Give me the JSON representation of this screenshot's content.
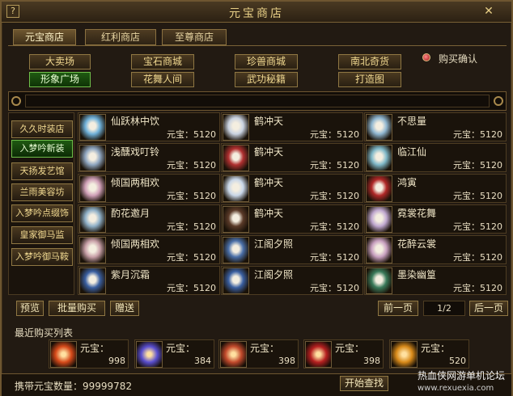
{
  "window": {
    "title": "元宝商店",
    "help": "?",
    "close": "✕"
  },
  "tabs": [
    "元宝商店",
    "红利商店",
    "至尊商店"
  ],
  "categories": [
    "大卖场",
    "宝石商城",
    "珍兽商城",
    "南北奇货",
    "形象广场",
    "花舞人间",
    "武功秘籍",
    "打造图"
  ],
  "confirm_label": "购买确认",
  "sidebar": [
    "久久时装店",
    "入梦吟新装",
    "天扬发艺馆",
    "兰雨美容坊",
    "入梦吟点缀饰",
    "皇家御马监",
    "入梦吟御马鞍"
  ],
  "price_prefix": "元宝：",
  "items": [
    {
      "name": "仙跃林中饮",
      "price": "5120"
    },
    {
      "name": "鹤冲天",
      "price": "5120"
    },
    {
      "name": "不思量",
      "price": "5120"
    },
    {
      "name": "浅醺戏叮铃",
      "price": "5120"
    },
    {
      "name": "鹤冲天",
      "price": "5120"
    },
    {
      "name": "临江仙",
      "price": "5120"
    },
    {
      "name": "倾国两相欢",
      "price": "5120"
    },
    {
      "name": "鹤冲天",
      "price": "5120"
    },
    {
      "name": "鸿寅",
      "price": "5120"
    },
    {
      "name": "酌花邀月",
      "price": "5120"
    },
    {
      "name": "鹤冲天",
      "price": "5120"
    },
    {
      "name": "霓裳花舞",
      "price": "5120"
    },
    {
      "name": "倾国两相欢",
      "price": "5120"
    },
    {
      "name": "江阁夕照",
      "price": "5120"
    },
    {
      "name": "花醉云裳",
      "price": "5120"
    },
    {
      "name": "紫月沉霜",
      "price": "5120"
    },
    {
      "name": "江阁夕照",
      "price": "5120"
    },
    {
      "name": "墨染幽篁",
      "price": "5120"
    }
  ],
  "actions": {
    "preview": "预览",
    "bulk": "批量购买",
    "gift": "赠送"
  },
  "pager": {
    "prev": "前一页",
    "page": "1/2",
    "next": "后一页"
  },
  "recent": {
    "title": "最近购买列表",
    "label": "元宝：",
    "entries": [
      {
        "qty": "998",
        "color": "#d64a1a"
      },
      {
        "qty": "384",
        "color": "#5a4fd0"
      },
      {
        "qty": "398",
        "color": "#c24a2c"
      },
      {
        "qty": "398",
        "color": "#b52020"
      },
      {
        "qty": "520",
        "color": "#d88a1a"
      }
    ]
  },
  "footer": {
    "carry": "携带元宝数量：99999782",
    "search": "开始查找"
  },
  "watermark": {
    "text": "热血侠网游单机论坛",
    "url": "www.rexuexia.com"
  },
  "item_colors": [
    "#6fb0d8",
    "#c9d2e0",
    "#8fb6d0",
    "#8fa6c0",
    "#b03030",
    "#7fb8c8",
    "#d0a0b8",
    "#c8d6e8",
    "#b02828",
    "#8fb0c8",
    "#5a3a28",
    "#c0a8d0",
    "#c8a0a8",
    "#4a6fa8",
    "#c8a0c0",
    "#3a5fa0",
    "#3a5fa0",
    "#3a7a5a"
  ]
}
